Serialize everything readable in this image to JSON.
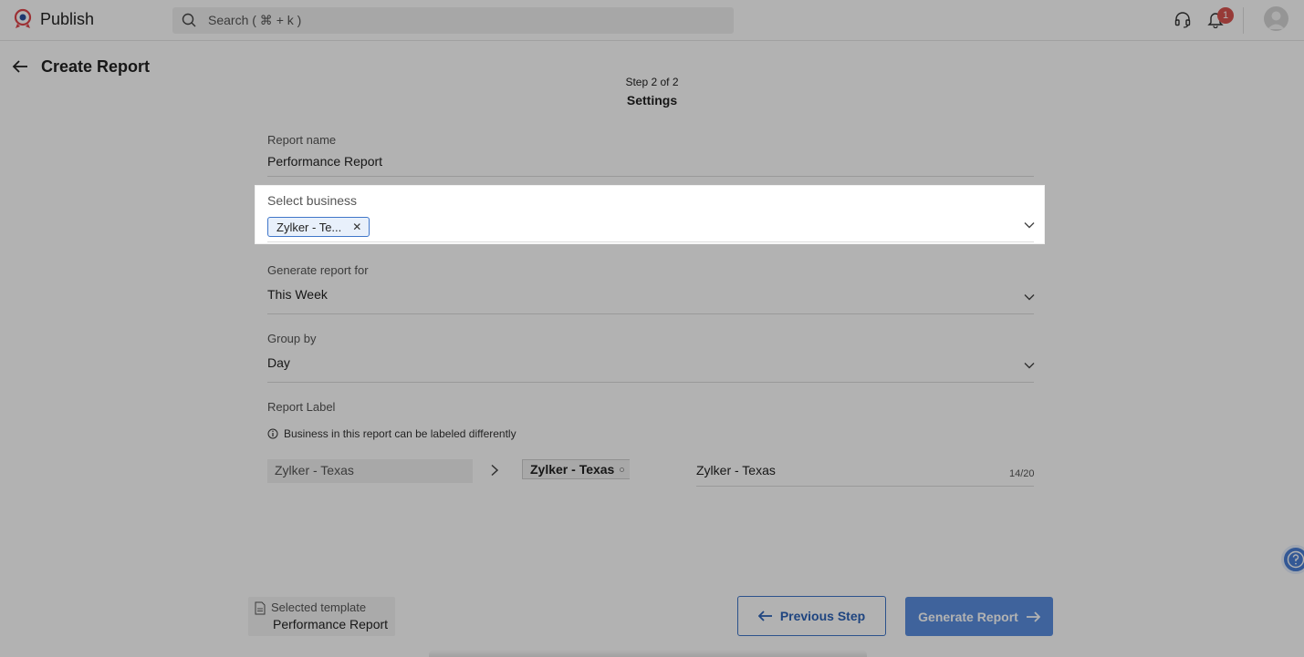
{
  "app": {
    "name": "Publish",
    "search_placeholder": "Search ( ⌘ + k )",
    "notification_count": "1"
  },
  "header": {
    "title": "Create Report",
    "step_caption": "Step 2 of 2",
    "step_title": "Settings"
  },
  "form": {
    "report_name": {
      "label": "Report name",
      "value": "Performance Report"
    },
    "select_business": {
      "label": "Select business",
      "chips": [
        "Zylker - Te..."
      ]
    },
    "generate_for": {
      "label": "Generate report for",
      "value": "This Week"
    },
    "group_by": {
      "label": "Group by",
      "value": "Day"
    },
    "report_label": {
      "label": "Report Label",
      "info": "Business in this report can be labeled differently",
      "source": "Zylker - Texas",
      "tag_preview": "Zylker - Texas",
      "input_value": "Zylker - Texas",
      "counter": "14/20"
    }
  },
  "footer": {
    "template_caption": "Selected template",
    "template_name": "Performance Report",
    "prev_label": "Previous Step",
    "generate_label": "Generate Report"
  },
  "colors": {
    "accent": "#3f76c9",
    "primary_button": "#5b8fe0",
    "badge": "#d9534f",
    "overlay": "rgba(0,0,0,0.30)"
  }
}
